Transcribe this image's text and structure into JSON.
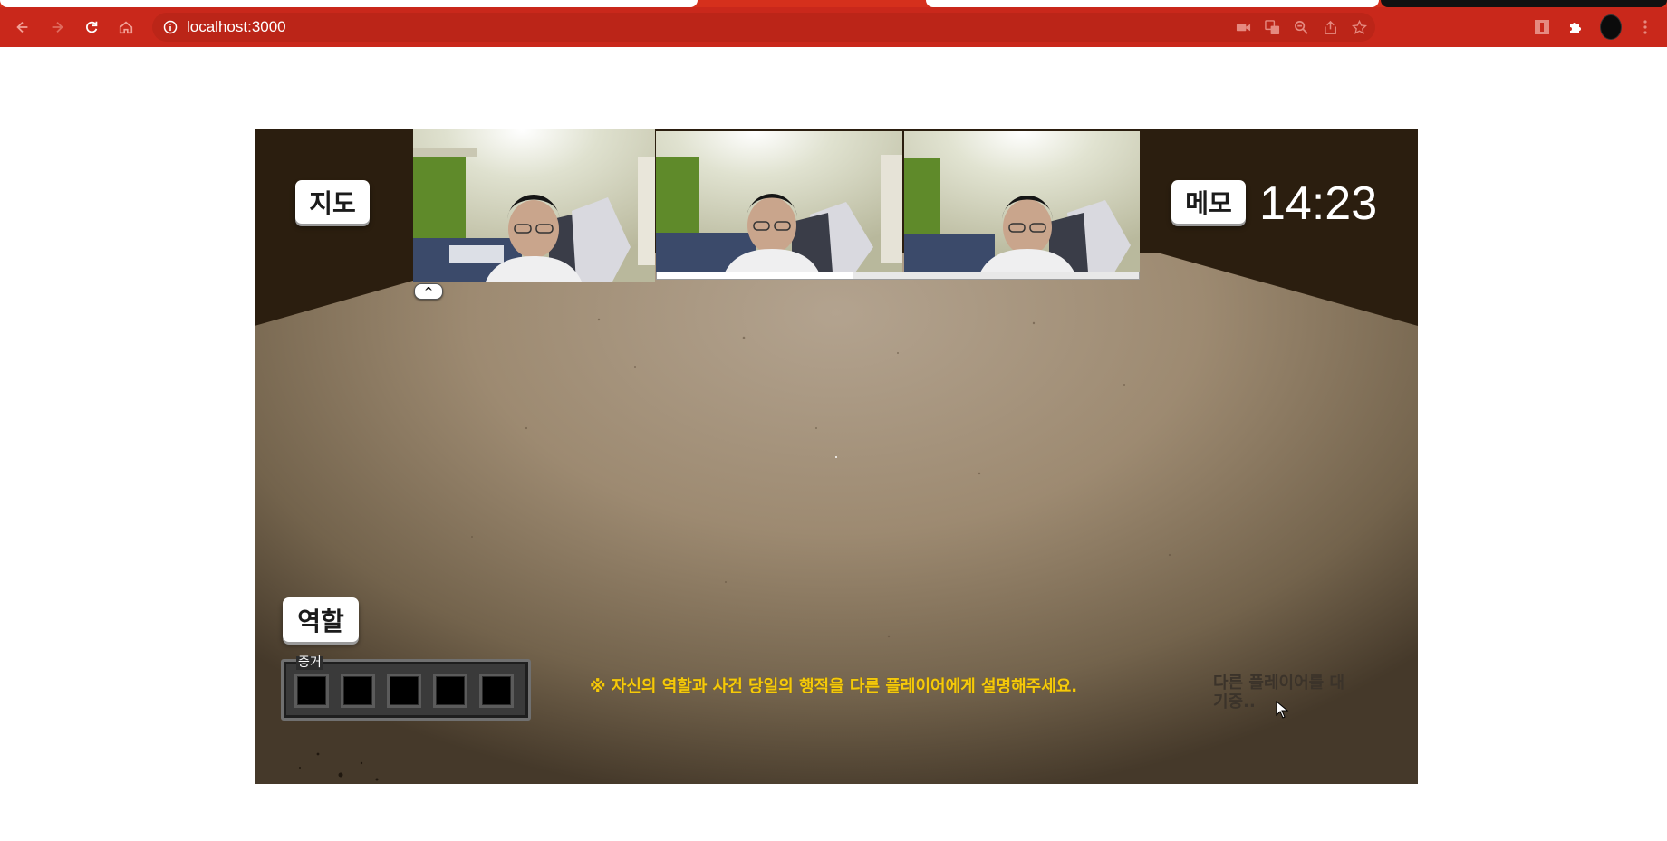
{
  "browser": {
    "url": "localhost:3000",
    "theme_color": "#c9281b"
  },
  "icons": {
    "nav": [
      "back-icon",
      "forward-icon",
      "reload-icon",
      "home-icon"
    ],
    "omnibox": [
      "camera-icon",
      "translate-icon",
      "zoom-icon",
      "share-icon",
      "star-icon"
    ],
    "tools": [
      "extension-badge-icon",
      "puzzle-icon",
      "profile-avatar",
      "menu-kebab-icon"
    ]
  },
  "game": {
    "map_label": "지도",
    "memo_label": "메모",
    "timer": "14:23",
    "role_label": "역할",
    "video_toggle": "^",
    "evidence": {
      "label": "증거",
      "slot_count": 5
    },
    "notice": "※ 자신의 역할과 사건 당일의 행적을 다른 플레이어에게 설명해주세요.",
    "waiting": "다른 플레이어를 대기중..",
    "colors": {
      "ceiling": "#2b1e0f",
      "notice": "#f5c90a",
      "button": "#ffffff"
    }
  }
}
